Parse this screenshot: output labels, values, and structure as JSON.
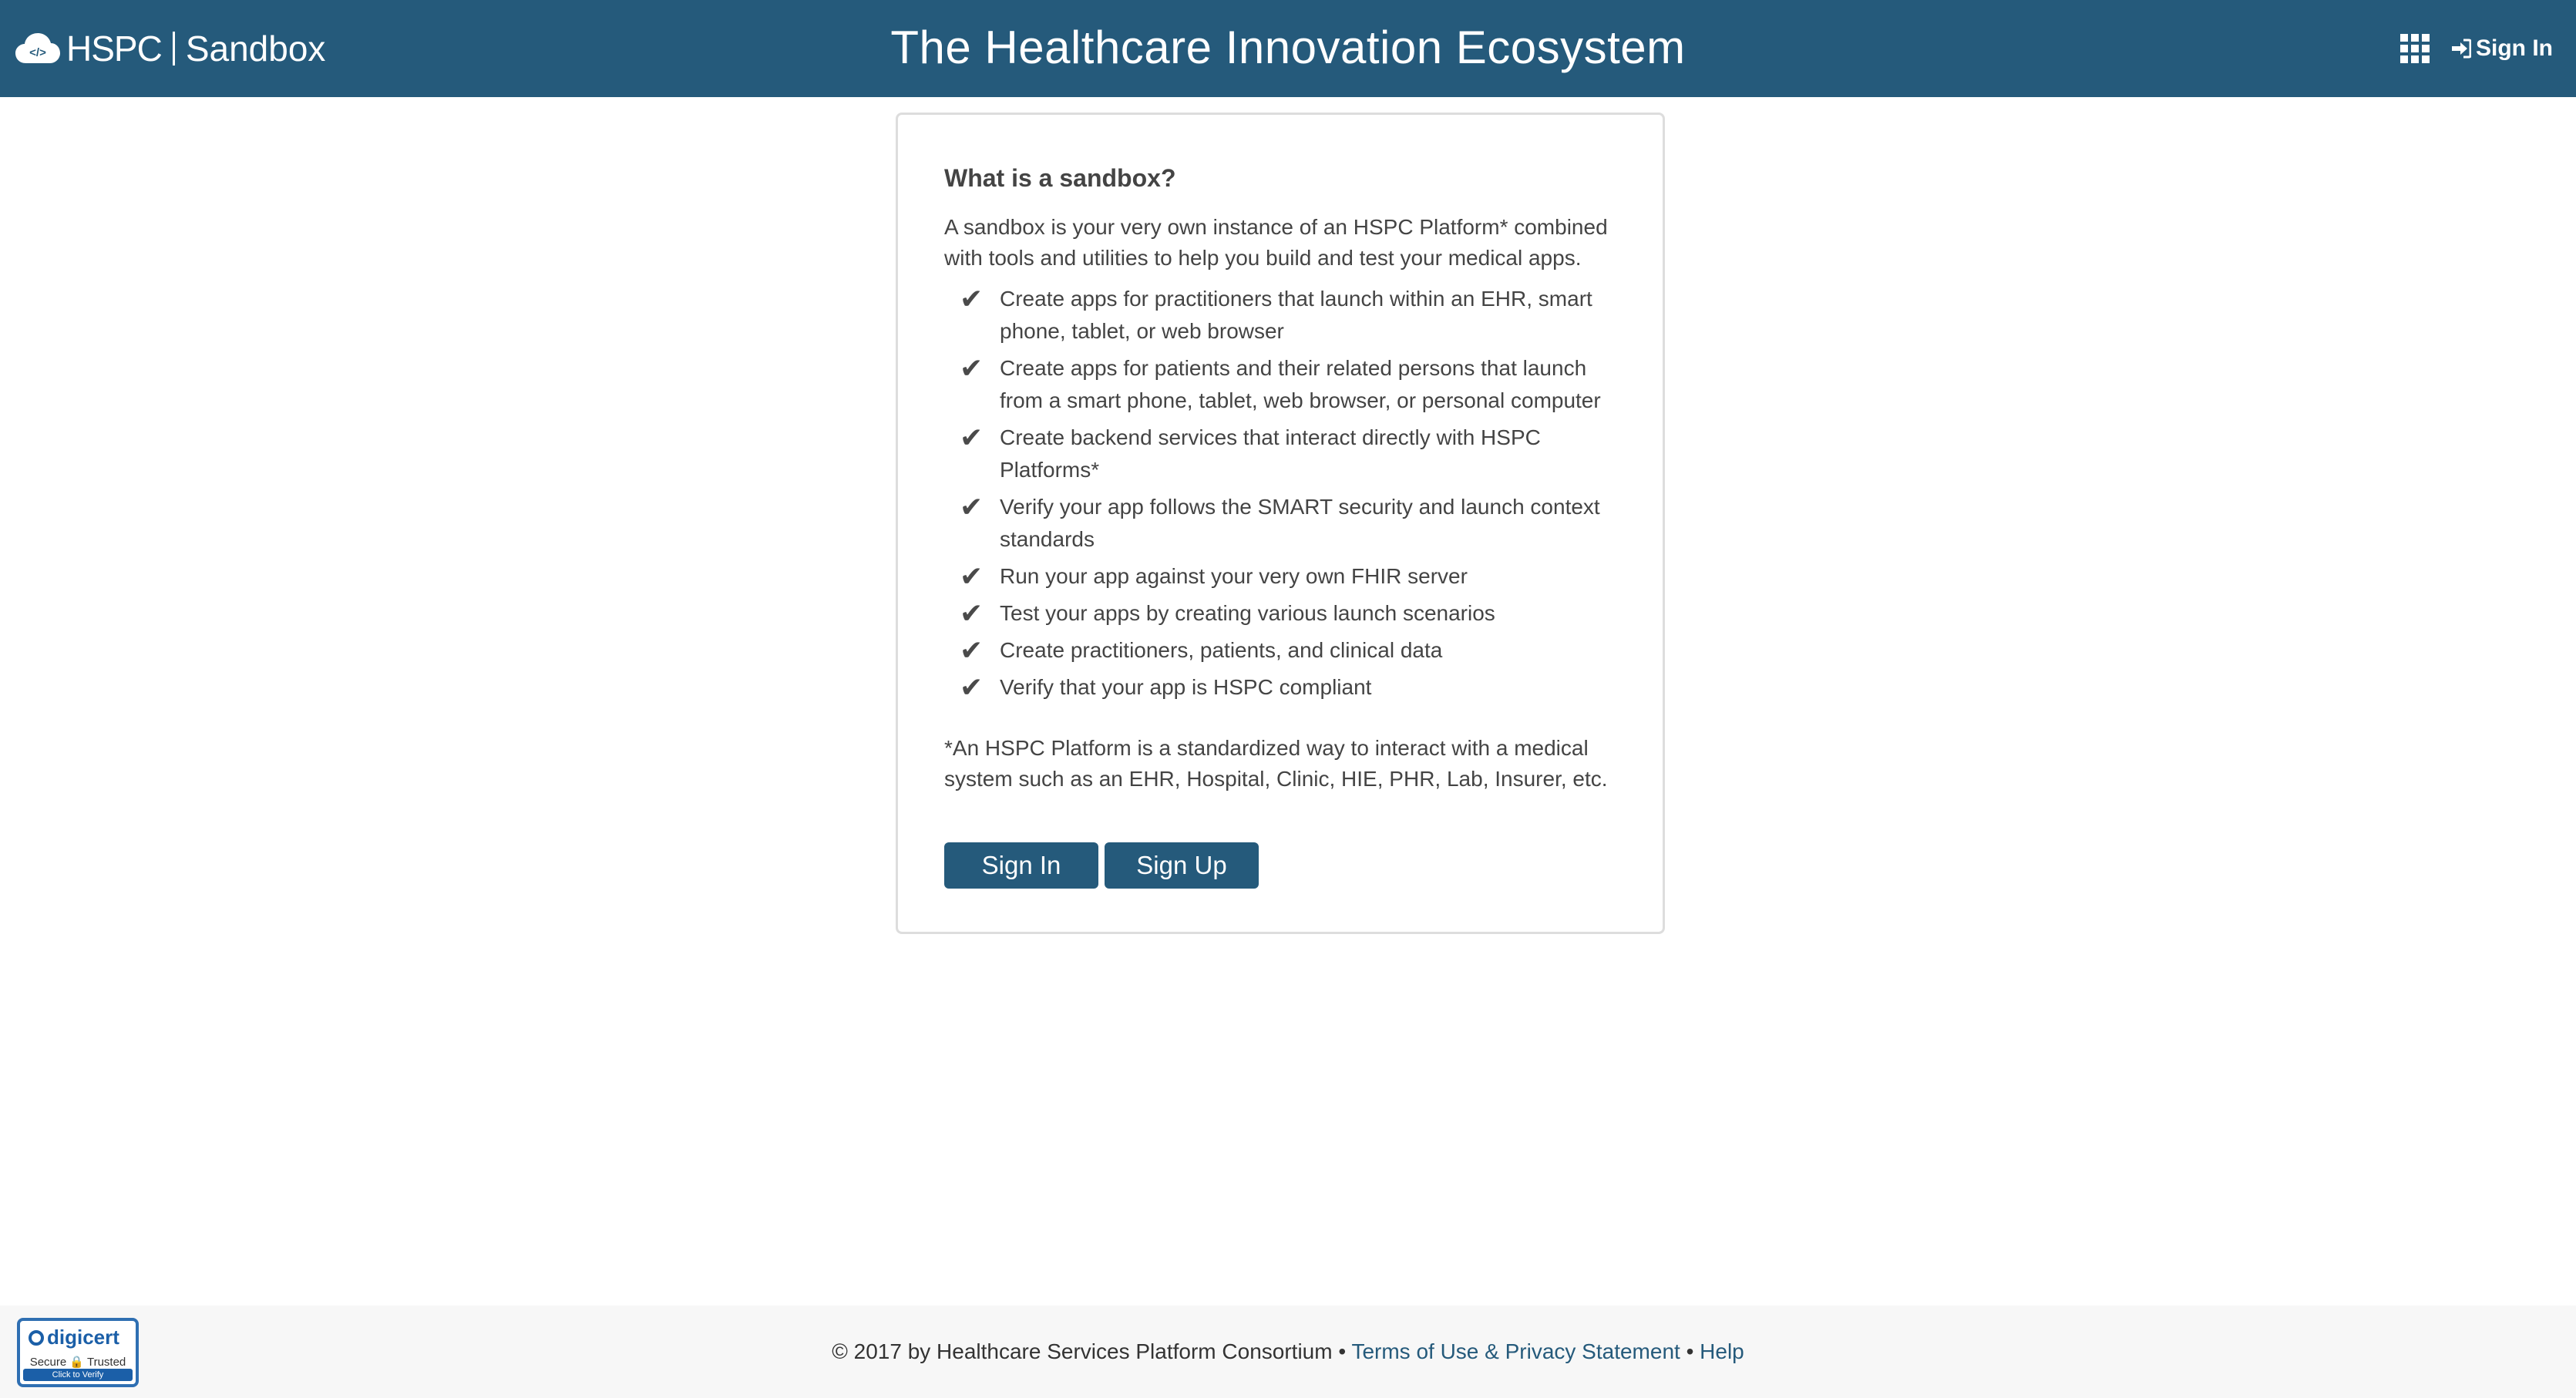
{
  "header": {
    "brand_left": "HSPC",
    "brand_right": "Sandbox",
    "title": "The Healthcare Innovation Ecosystem",
    "signin_label": "Sign In",
    "apps_icon": "grid-icon",
    "signin_icon": "sign-in-icon",
    "background_color": "#255a7b"
  },
  "card": {
    "heading": "What is a sandbox?",
    "intro": "A sandbox is your very own instance of an HSPC Platform* combined with tools and utilities to help you build and test your medical apps.",
    "check_glyph": "✔",
    "features": [
      "Create apps for practitioners that launch within an EHR, smart phone, tablet, or web browser",
      "Create apps for patients and their related persons that launch from a smart phone, tablet, web browser, or personal computer",
      "Create backend services that interact directly with HSPC Platforms*",
      "Verify your app follows the SMART security and launch context standards",
      "Run your app against your very own FHIR server",
      "Test your apps by creating various launch scenarios",
      "Create practitioners, patients, and clinical data",
      "Verify that your app is HSPC compliant"
    ],
    "footnote": "*An HSPC Platform is a standardized way to interact with a medical system such as an EHR, Hospital, Clinic, HIE, PHR, Lab, Insurer, etc.",
    "signin_button": "Sign In",
    "signup_button": "Sign Up",
    "button_color": "#255a7b"
  },
  "footer": {
    "copyright": "© 2017 by Healthcare Services Platform Consortium",
    "bullet": " • ",
    "terms_link": "Terms of Use & Privacy Statement",
    "help_link": "Help",
    "seal": {
      "brand": "digicert",
      "sub": "Secure 🔒 Trusted",
      "verify": "Click to Verify"
    }
  }
}
